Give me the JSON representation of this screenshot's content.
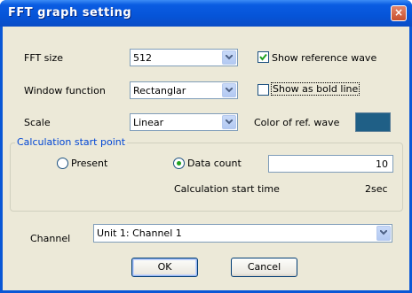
{
  "window": {
    "title": "FFT graph setting",
    "close_glyph": "×"
  },
  "fft_size": {
    "label": "FFT size",
    "value": "512"
  },
  "window_function": {
    "label": "Window function",
    "value": "Rectanglar"
  },
  "scale": {
    "label": "Scale",
    "value": "Linear"
  },
  "show_reference_wave": {
    "label": "Show reference wave",
    "checked": true
  },
  "show_as_bold_line": {
    "label": "Show as bold line",
    "checked": false
  },
  "color_of_ref_wave": {
    "label": "Color of ref. wave",
    "color": "#1f5f86"
  },
  "calc_start_point": {
    "title": "Calculation start point",
    "present_label": "Present",
    "data_count_label": "Data count",
    "selected": "data_count",
    "data_count_value": "10",
    "start_time_label": "Calculation start time",
    "start_time_value": "2sec"
  },
  "channel": {
    "label": "Channel",
    "value": "Unit 1: Channel 1"
  },
  "buttons": {
    "ok": "OK",
    "cancel": "Cancel"
  },
  "colors": {
    "title_bar": "#0654d8",
    "dialog_bg": "#ece9d8",
    "group_title": "#0046d5",
    "checkmark": "#21a121"
  }
}
